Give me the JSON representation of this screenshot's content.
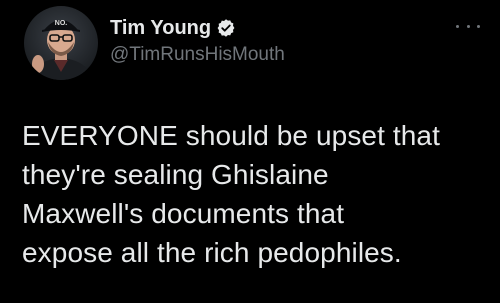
{
  "tweet": {
    "author": {
      "display_name": "Tim Young",
      "handle": "@TimRunsHisMouth",
      "verified": true,
      "avatar_hat_text": "NO."
    },
    "more_menu_icon": "more-horizontal-icon",
    "text_lines": [
      "EVERYONE should be upset that",
      "they're sealing Ghislaine",
      "Maxwell's documents that",
      "expose all the rich pedophiles."
    ],
    "colors": {
      "background": "#000000",
      "text": "#e7e9ea",
      "secondary": "#71767b",
      "verified_badge": "#1d9bf0"
    }
  }
}
